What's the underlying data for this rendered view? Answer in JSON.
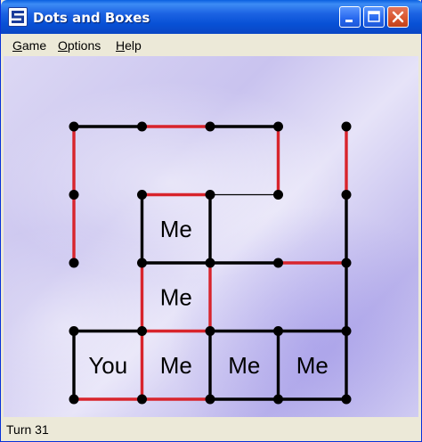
{
  "window": {
    "title": "Dots and Boxes"
  },
  "menu": [
    {
      "mnemonic": "G",
      "rest": "ame"
    },
    {
      "mnemonic": "O",
      "rest": "ptions"
    },
    {
      "mnemonic": "H",
      "rest": "elp"
    }
  ],
  "status": {
    "text": "Turn 31"
  },
  "colors": {
    "line_player": "#000000",
    "line_computer": "#d8242c",
    "line_last": "#000000",
    "dot": "#000000"
  },
  "board": {
    "dots_cols": 5,
    "dots_rows": 5,
    "lines": [
      {
        "from": [
          0,
          0
        ],
        "to": [
          1,
          0
        ],
        "owner": "player"
      },
      {
        "from": [
          1,
          0
        ],
        "to": [
          2,
          0
        ],
        "owner": "computer"
      },
      {
        "from": [
          2,
          0
        ],
        "to": [
          3,
          0
        ],
        "owner": "player"
      },
      {
        "from": [
          0,
          0
        ],
        "to": [
          0,
          1
        ],
        "owner": "computer"
      },
      {
        "from": [
          3,
          0
        ],
        "to": [
          3,
          1
        ],
        "owner": "computer"
      },
      {
        "from": [
          4,
          0
        ],
        "to": [
          4,
          1
        ],
        "owner": "computer"
      },
      {
        "from": [
          1,
          1
        ],
        "to": [
          2,
          1
        ],
        "owner": "computer"
      },
      {
        "from": [
          2,
          1
        ],
        "to": [
          3,
          1
        ],
        "owner": "last"
      },
      {
        "from": [
          0,
          1
        ],
        "to": [
          0,
          2
        ],
        "owner": "computer"
      },
      {
        "from": [
          1,
          1
        ],
        "to": [
          1,
          2
        ],
        "owner": "player"
      },
      {
        "from": [
          2,
          1
        ],
        "to": [
          2,
          2
        ],
        "owner": "player"
      },
      {
        "from": [
          4,
          1
        ],
        "to": [
          4,
          2
        ],
        "owner": "player"
      },
      {
        "from": [
          1,
          2
        ],
        "to": [
          2,
          2
        ],
        "owner": "player"
      },
      {
        "from": [
          2,
          2
        ],
        "to": [
          3,
          2
        ],
        "owner": "player"
      },
      {
        "from": [
          3,
          2
        ],
        "to": [
          4,
          2
        ],
        "owner": "computer"
      },
      {
        "from": [
          1,
          2
        ],
        "to": [
          1,
          3
        ],
        "owner": "computer"
      },
      {
        "from": [
          2,
          2
        ],
        "to": [
          2,
          3
        ],
        "owner": "computer"
      },
      {
        "from": [
          4,
          2
        ],
        "to": [
          4,
          3
        ],
        "owner": "player"
      },
      {
        "from": [
          0,
          3
        ],
        "to": [
          1,
          3
        ],
        "owner": "player"
      },
      {
        "from": [
          1,
          3
        ],
        "to": [
          2,
          3
        ],
        "owner": "computer"
      },
      {
        "from": [
          2,
          3
        ],
        "to": [
          3,
          3
        ],
        "owner": "player"
      },
      {
        "from": [
          3,
          3
        ],
        "to": [
          4,
          3
        ],
        "owner": "player"
      },
      {
        "from": [
          0,
          3
        ],
        "to": [
          0,
          4
        ],
        "owner": "player"
      },
      {
        "from": [
          1,
          3
        ],
        "to": [
          1,
          4
        ],
        "owner": "computer"
      },
      {
        "from": [
          2,
          3
        ],
        "to": [
          2,
          4
        ],
        "owner": "player"
      },
      {
        "from": [
          3,
          3
        ],
        "to": [
          3,
          4
        ],
        "owner": "player"
      },
      {
        "from": [
          4,
          3
        ],
        "to": [
          4,
          4
        ],
        "owner": "player"
      },
      {
        "from": [
          0,
          4
        ],
        "to": [
          1,
          4
        ],
        "owner": "computer"
      },
      {
        "from": [
          1,
          4
        ],
        "to": [
          2,
          4
        ],
        "owner": "computer"
      },
      {
        "from": [
          2,
          4
        ],
        "to": [
          3,
          4
        ],
        "owner": "player"
      },
      {
        "from": [
          3,
          4
        ],
        "to": [
          4,
          4
        ],
        "owner": "player"
      }
    ],
    "boxes": [
      {
        "cell": [
          1,
          1
        ],
        "label": "Me"
      },
      {
        "cell": [
          1,
          2
        ],
        "label": "Me"
      },
      {
        "cell": [
          0,
          3
        ],
        "label": "You"
      },
      {
        "cell": [
          1,
          3
        ],
        "label": "Me"
      },
      {
        "cell": [
          2,
          3
        ],
        "label": "Me"
      },
      {
        "cell": [
          3,
          3
        ],
        "label": "Me"
      }
    ]
  }
}
